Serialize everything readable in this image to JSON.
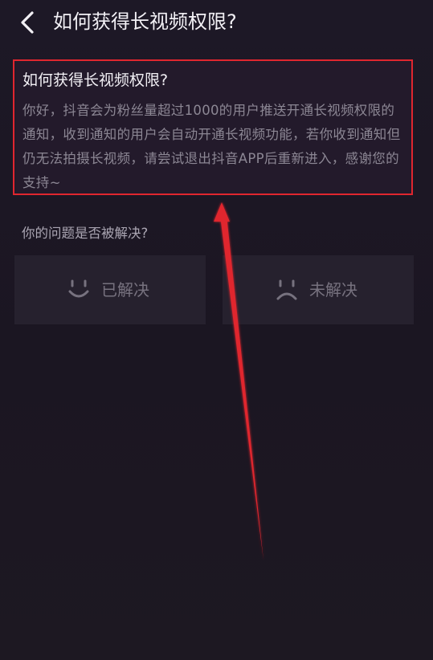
{
  "header": {
    "title": "如何获得长视频权限?"
  },
  "answer": {
    "title": "如何获得长视频权限?",
    "body": "你好，抖音会为粉丝量超过1000的用户推送开通长视频权限的通知，收到通知的用户会自动开通长视频功能，若你收到通知但仍无法拍摄长视频，请尝试退出抖音APP后重新进入，感谢您的支持~"
  },
  "feedback": {
    "question": "你的问题是否被解决?",
    "resolved_label": "已解决",
    "unresolved_label": "未解决",
    "resolved_icon": "smile-face-icon",
    "unresolved_icon": "sad-face-icon"
  },
  "annotation": {
    "highlight_color": "#e0262f",
    "arrow_color": "#e0262f"
  }
}
